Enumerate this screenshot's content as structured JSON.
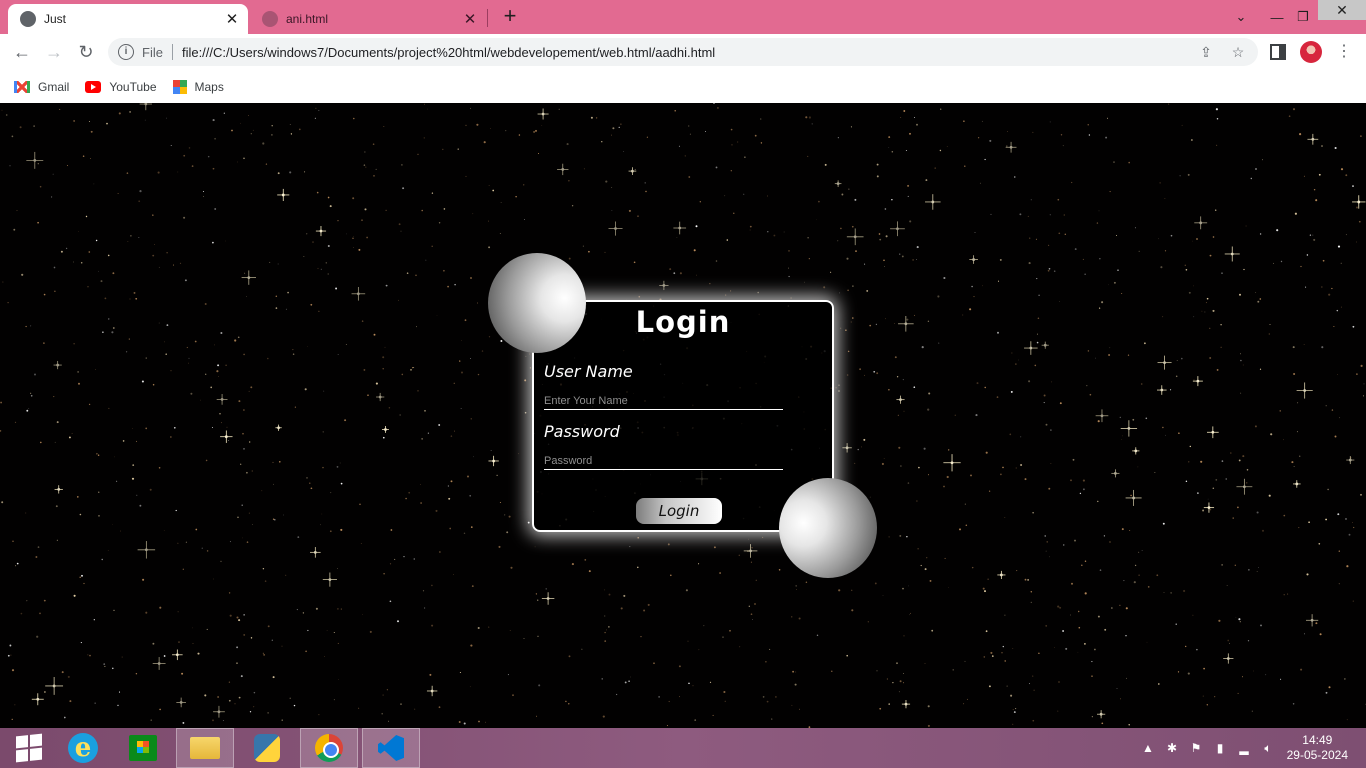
{
  "browser": {
    "tabs": [
      {
        "title": "Just",
        "active": true
      },
      {
        "title": "ani.html",
        "active": false
      }
    ],
    "address": {
      "scheme_label": "File",
      "url": "file:///C:/Users/windows7/Documents/project%20html/webdevelopement/web.html/aadhi.html"
    },
    "bookmarks": [
      {
        "label": "Gmail",
        "icon": "gmail-icon"
      },
      {
        "label": "YouTube",
        "icon": "youtube-icon"
      },
      {
        "label": "Maps",
        "icon": "maps-icon"
      }
    ],
    "accent_color": "#e26a91"
  },
  "login": {
    "title": "Login",
    "username_label": "User Name",
    "username_placeholder": "Enter Your Name",
    "password_label": "Password",
    "password_placeholder": "Password",
    "button_label": "Login"
  },
  "taskbar": {
    "apps": [
      "start-icon",
      "internet-explorer-icon",
      "store-icon",
      "file-explorer-icon",
      "python-icon",
      "chrome-icon",
      "vscode-icon"
    ],
    "clock_time": "14:49",
    "clock_date": "29-05-2024",
    "color": "#8e5b7f"
  }
}
